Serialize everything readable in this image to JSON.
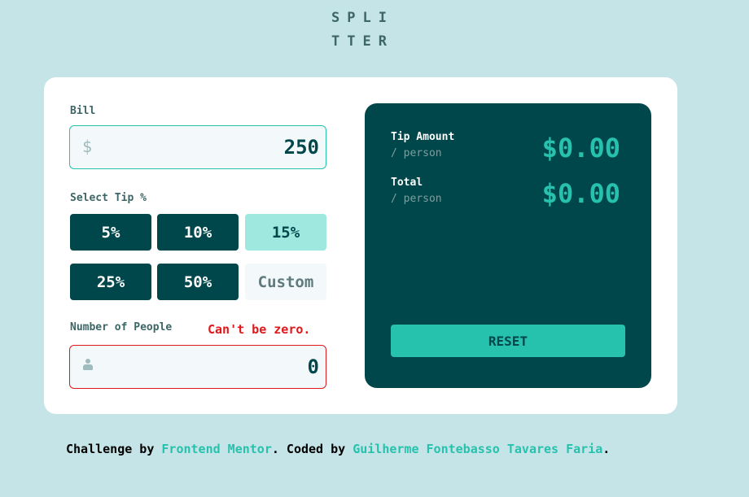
{
  "logo": {
    "line1": "SPLI",
    "line2": "TTER"
  },
  "bill": {
    "label": "Bill",
    "prefix": "$",
    "value": "250"
  },
  "tip": {
    "label": "Select Tip %",
    "options": [
      "5%",
      "10%",
      "15%",
      "25%",
      "50%"
    ],
    "selected": "15%",
    "custom_placeholder": "Custom"
  },
  "people": {
    "label": "Number of People",
    "error": "Can't be zero.",
    "value": "0"
  },
  "results": {
    "tip_amount": {
      "title": "Tip Amount",
      "sub": "/ person",
      "value": "$0.00"
    },
    "total": {
      "title": "Total",
      "sub": "/ person",
      "value": "$0.00"
    },
    "reset_label": "RESET"
  },
  "attribution": {
    "prefix": "Challenge by ",
    "link1": "Frontend Mentor",
    "middle": ". Coded by ",
    "link2": "Guilherme Fontebasso Tavares Faria",
    "suffix": "."
  },
  "colors": {
    "background": "#c5e4e7",
    "dark_cyan": "#00474b",
    "strong_cyan": "#26c2ae",
    "error": "#e0181b"
  }
}
